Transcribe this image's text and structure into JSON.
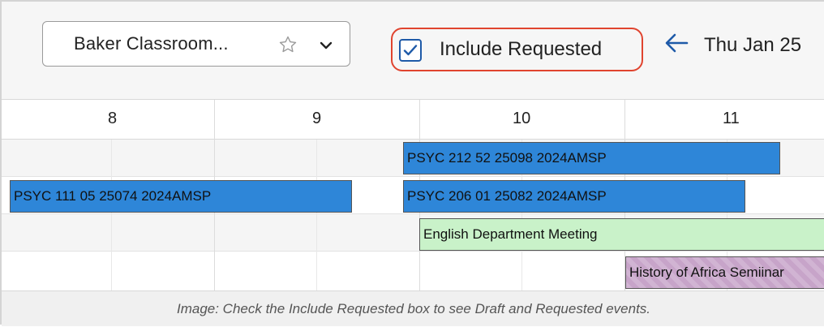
{
  "toolbar": {
    "location_select": {
      "label": "Baker Classroom...",
      "favorite_icon": "star-outline-icon",
      "dropdown_icon": "chevron-down-icon"
    },
    "include_requested": {
      "label": "Include Requested",
      "checked": true
    },
    "nav": {
      "prev_icon": "arrow-left-icon",
      "date": "Thu Jan 25"
    }
  },
  "timeline": {
    "hours": [
      "8",
      "9",
      "10",
      "11"
    ],
    "events": [
      {
        "title": "PSYC 212 52 25098 2024AMSP",
        "color": "#2e86d8"
      },
      {
        "title": "PSYC 111 05 25074 2024AMSP",
        "color": "#2e86d8"
      },
      {
        "title": "PSYC 206 01 25082 2024AMSP",
        "color": "#2e86d8"
      },
      {
        "title": "English Department Meeting",
        "color": "#c9f2c9"
      },
      {
        "title": "History of Africa Semiinar",
        "color": "#c7a4c9"
      }
    ]
  },
  "caption": "Image: Check the Include Requested box to see Draft and Requested events."
}
